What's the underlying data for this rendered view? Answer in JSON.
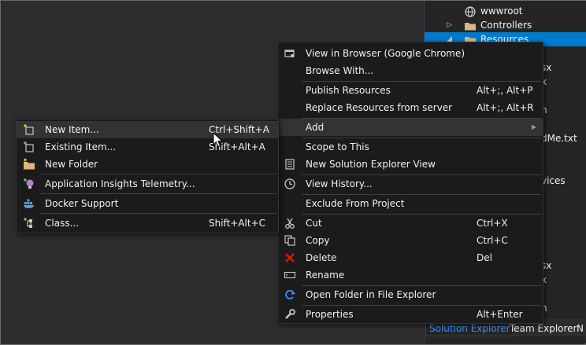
{
  "solution_explorer": {
    "tree": [
      {
        "label": "wwwroot",
        "expander": "",
        "icon": "globe-icon"
      },
      {
        "label": "Controllers",
        "expander": "▷",
        "icon": "folder-icon"
      },
      {
        "label": "Resources",
        "expander": "◢",
        "icon": "folder-icon"
      }
    ],
    "fragments": [
      "sx",
      "x",
      "n",
      "dMe.txt",
      "vices",
      "sx",
      "x",
      "n"
    ],
    "tabs": [
      "Solution Explorer",
      "Team Explorer",
      "N"
    ]
  },
  "context_menu": {
    "items": [
      {
        "label": "View in Browser (Google Chrome)",
        "shortcut": "",
        "icon": "browser-view-icon"
      },
      {
        "label": "Browse With...",
        "shortcut": "",
        "icon": ""
      },
      {
        "label": "Publish Resources",
        "shortcut": "Alt+;, Alt+P",
        "icon": ""
      },
      {
        "label": "Replace Resources from server",
        "shortcut": "Alt+;, Alt+R",
        "icon": ""
      },
      {
        "label": "Add",
        "shortcut": "",
        "icon": ""
      },
      {
        "label": "Scope to This",
        "shortcut": "",
        "icon": ""
      },
      {
        "label": "New Solution Explorer View",
        "shortcut": "",
        "icon": "new-view-icon"
      },
      {
        "label": "View History...",
        "shortcut": "",
        "icon": "history-icon"
      },
      {
        "label": "Exclude From Project",
        "shortcut": "",
        "icon": ""
      },
      {
        "label": "Cut",
        "shortcut": "Ctrl+X",
        "icon": "scissors-icon"
      },
      {
        "label": "Copy",
        "shortcut": "Ctrl+C",
        "icon": "copy-icon"
      },
      {
        "label": "Delete",
        "shortcut": "Del",
        "icon": "delete-icon"
      },
      {
        "label": "Rename",
        "shortcut": "",
        "icon": "rename-icon"
      },
      {
        "label": "Open Folder in File Explorer",
        "shortcut": "",
        "icon": "refresh-icon"
      },
      {
        "label": "Properties",
        "shortcut": "Alt+Enter",
        "icon": "wrench-icon"
      }
    ]
  },
  "add_submenu": {
    "items": [
      {
        "label": "New Item...",
        "shortcut": "Ctrl+Shift+A",
        "icon": "new-item-icon"
      },
      {
        "label": "Existing Item...",
        "shortcut": "Shift+Alt+A",
        "icon": "existing-item-icon"
      },
      {
        "label": "New Folder",
        "shortcut": "",
        "icon": "new-folder-icon"
      },
      {
        "label": "Application Insights Telemetry...",
        "shortcut": "",
        "icon": "app-insights-icon"
      },
      {
        "label": "Docker Support",
        "shortcut": "",
        "icon": "docker-icon"
      },
      {
        "label": "Class...",
        "shortcut": "Shift+Alt+C",
        "icon": "class-icon"
      }
    ]
  },
  "colors": {
    "accent": "#007acc",
    "menu_bg": "#1b1b1c",
    "hover_bg": "#333334",
    "delete_red": "#e51400",
    "link_blue": "#3794ff"
  }
}
